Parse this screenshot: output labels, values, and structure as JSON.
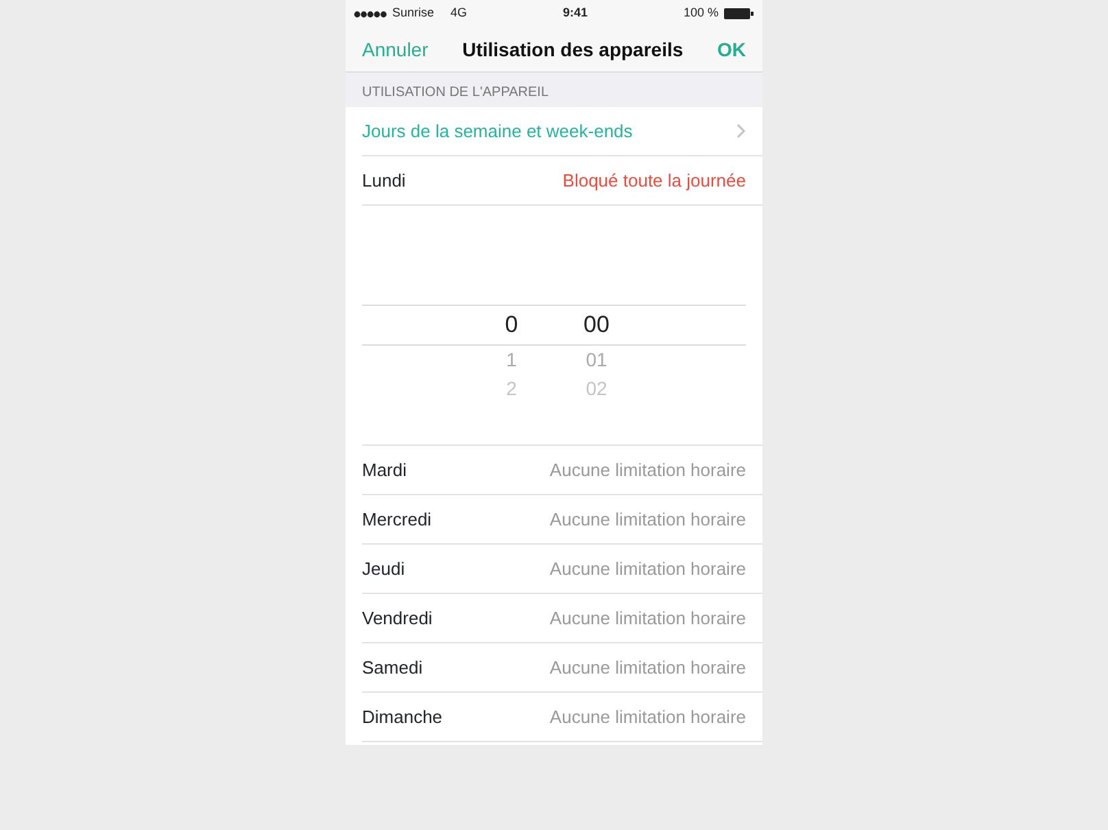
{
  "status_bar": {
    "carrier": "Sunrise",
    "network": "4G",
    "time": "9:41",
    "battery": "100 %"
  },
  "nav": {
    "cancel": "Annuler",
    "title": "Utilisation des appareils",
    "done": "OK"
  },
  "section_header": "UTILISATION DE L'APPAREIL",
  "link_row": {
    "label": "Jours de la semaine et week-ends"
  },
  "expanded_day": {
    "day": "Lundi",
    "value": "Bloqué toute la journée",
    "kind": "blocked"
  },
  "picker": {
    "rows": [
      {
        "hour": "0",
        "minute": "00",
        "selected": true
      },
      {
        "hour": "1",
        "minute": "01",
        "selected": false
      },
      {
        "hour": "2",
        "minute": "02",
        "selected": false
      }
    ]
  },
  "days": [
    {
      "day": "Mardi",
      "value": "Aucune limitation horaire",
      "kind": "none"
    },
    {
      "day": "Mercredi",
      "value": "Aucune limitation horaire",
      "kind": "none"
    },
    {
      "day": "Jeudi",
      "value": "Aucune limitation horaire",
      "kind": "none"
    },
    {
      "day": "Vendredi",
      "value": "Aucune limitation horaire",
      "kind": "none"
    },
    {
      "day": "Samedi",
      "value": "Aucune limitation horaire",
      "kind": "none"
    },
    {
      "day": "Dimanche",
      "value": "Aucune limitation horaire",
      "kind": "none"
    }
  ]
}
